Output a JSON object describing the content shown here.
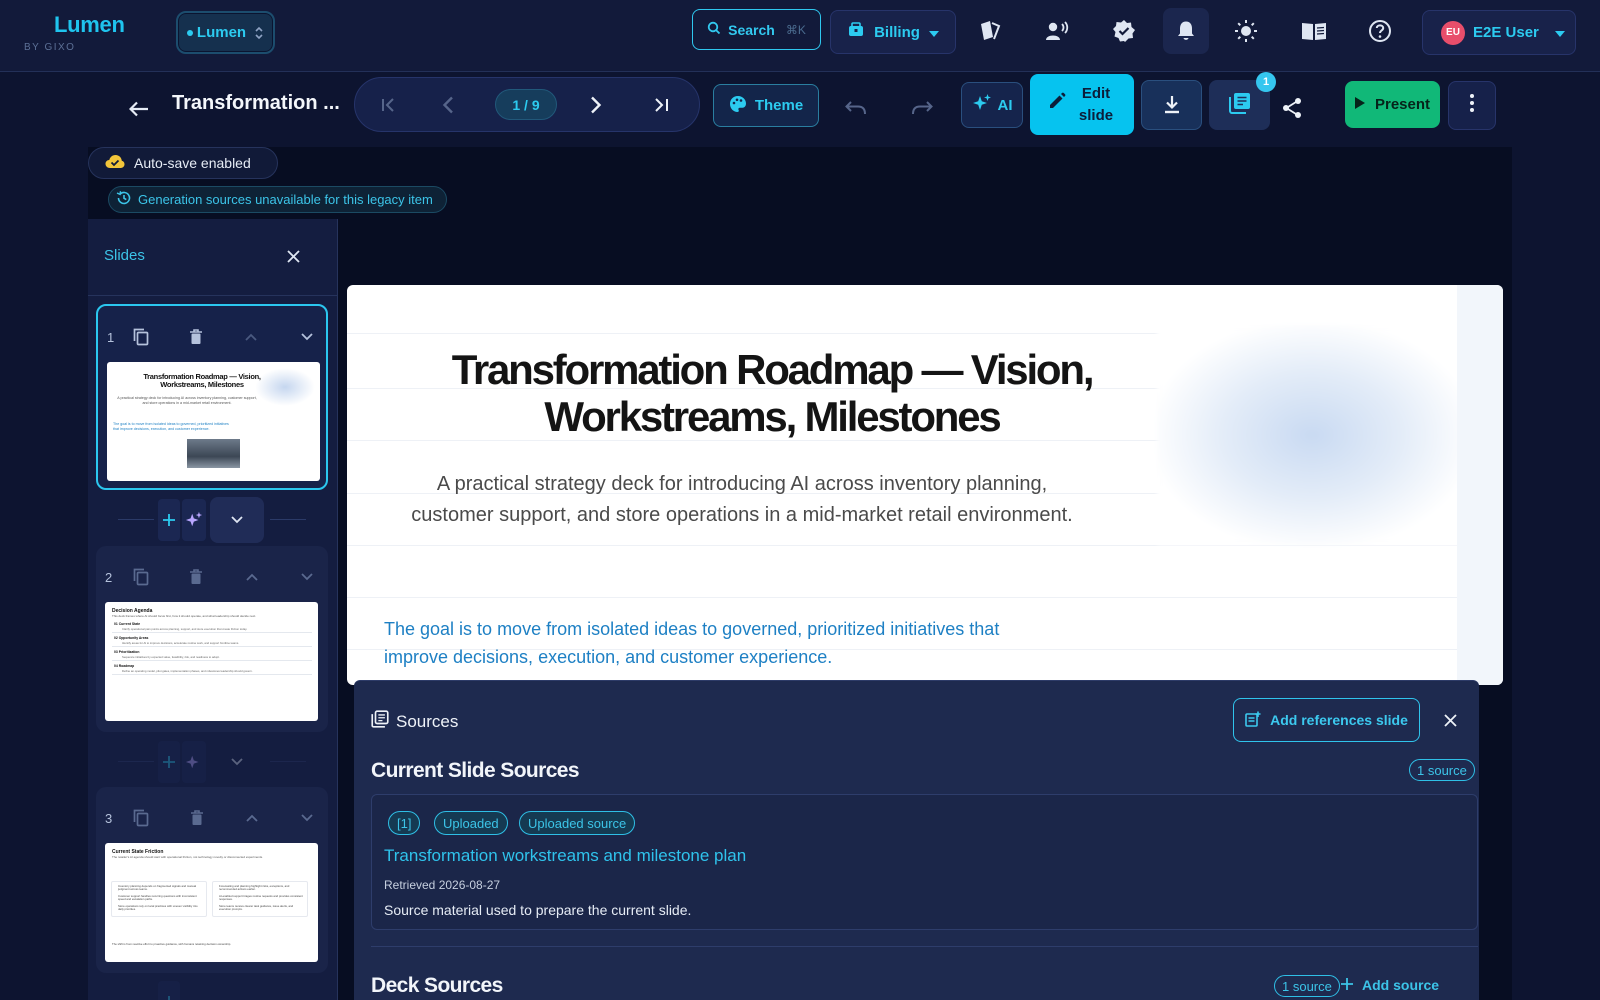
{
  "brand": {
    "name": "Lumen",
    "sub": "BY GIXO"
  },
  "workspace": {
    "label": "Lumen"
  },
  "search": {
    "label": "Search",
    "shortcut": "⌘K"
  },
  "billing": {
    "label": "Billing"
  },
  "user": {
    "initials": "EU",
    "name": "E2E User"
  },
  "editor": {
    "deck_title": "Transformation ...",
    "page_indicator": "1 / 9",
    "theme_label": "Theme",
    "ai_label": "AI",
    "edit_label": "Edit slide",
    "sources_badge": "1",
    "present_label": "Present"
  },
  "notices": {
    "autosave": "Auto-save enabled",
    "legacy": "Generation sources unavailable for this legacy item"
  },
  "slides_panel": {
    "title": "Slides",
    "slides": [
      {
        "number": "1",
        "thumb_title": "Transformation Roadmap — Vision, Workstreams, Milestones",
        "thumb_sub": "A practical strategy deck for introducing AI across inventory planning, customer support, and store operations in a mid-market retail environment.",
        "thumb_goal": "The goal is to move from isolated ideas to governed, prioritized initiatives that improve decisions, execution, and customer experience."
      },
      {
        "number": "2",
        "thumb_title": "Decision Agenda",
        "thumb_sub": "This deck frames where AI should focus first, how it should operate, and what leadership should decide next.",
        "rows": [
          {
            "label": "01  Current State",
            "text": "Clarify operational pain points across planning, support, and store execution that create friction today."
          },
          {
            "label": "02  Opportunity Areas",
            "text": "Identify areas for AI to improve decisions, accelerate routine work, and support frontline teams."
          },
          {
            "label": "03  Prioritization",
            "text": "Sequence initiatives by expected value, feasibility, risk, and readiness to adopt."
          },
          {
            "label": "04  Roadmap",
            "text": "Define an operating model, pilot gates, implementation phases, and milestones leadership should govern."
          }
        ]
      },
      {
        "number": "3",
        "thumb_title": "Current State Friction",
        "thumb_sub": "The retailer's AI agenda should start with operational friction, not technology novelty or disconnected experiments.",
        "left": [
          "Inventory planning depends on fragmented signals and manual judgment across teams.",
          "Customer support handles recurring questions with inconsistent speed and escalation paths.",
          "Store operations rely on local practices with uneven visibility into daily priorities."
        ],
        "right": [
          "Forecasting and planning highlight risks, exceptions, and recommended actions earlier.",
          "AI-enabled support triages routine requests and provides consistent responses.",
          "Store teams receive clearer task guidance, issue alerts, and execution prompts."
        ],
        "foot": "The shift is from reactive effort to proactive guidance, with humans retaining decision ownership."
      }
    ]
  },
  "main_slide": {
    "title": "Transformation Roadmap — Vision, Workstreams, Milestones",
    "subtitle": "A practical strategy deck for introducing AI across inventory planning, customer support, and store operations in a mid-market retail environment.",
    "goal": "The goal is to move from isolated ideas to governed, prioritized initiatives that improve decisions, execution, and customer experience."
  },
  "sources_panel": {
    "title": "Sources",
    "add_references_label": "Add references slide",
    "current_title": "Current Slide Sources",
    "current_count": "1 source",
    "item": {
      "index": "[1]",
      "tag_uploaded": "Uploaded",
      "tag_source": "Uploaded source",
      "title": "Transformation workstreams and milestone plan",
      "retrieved": "Retrieved 2026-08-27",
      "description": "Source material used to prepare the current slide."
    },
    "deck_title": "Deck Sources",
    "deck_count": "1 source",
    "add_source_label": "Add source"
  },
  "colors": {
    "accent": "#2ccbf0",
    "present": "#11b878",
    "edit": "#06c3ef",
    "avatar": "#e84e6b",
    "goal_text": "#1e80c4"
  }
}
